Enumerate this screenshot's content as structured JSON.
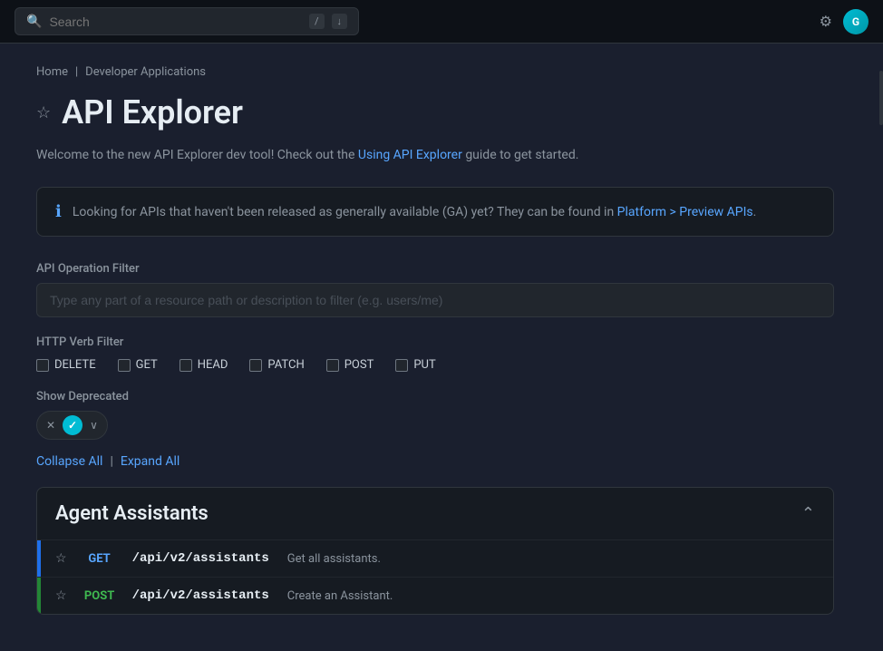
{
  "topbar": {
    "search_placeholder": "Search",
    "shortcut1": "/",
    "shortcut2": "↓",
    "settings_icon": "⚙",
    "avatar_text": "G"
  },
  "breadcrumb": {
    "home": "Home",
    "separator": "|",
    "current": "Developer Applications"
  },
  "page": {
    "star_icon": "☆",
    "title": "API Explorer",
    "subtitle_before": "Welcome to the new API Explorer dev tool! Check out the ",
    "subtitle_link_text": "Using API Explorer",
    "subtitle_after": " guide to get started."
  },
  "info_banner": {
    "icon": "ℹ",
    "text_before": "Looking for APIs that haven't been released as generally available (GA) yet? They can be found in ",
    "link_text": "Platform > Preview APIs",
    "text_after": "."
  },
  "filter": {
    "operation_label": "API Operation Filter",
    "operation_placeholder": "Type any part of a resource path or description to filter (e.g. users/me)",
    "verb_label": "HTTP Verb Filter",
    "verbs": [
      {
        "label": "DELETE",
        "checked": false
      },
      {
        "label": "GET",
        "checked": false
      },
      {
        "label": "HEAD",
        "checked": false
      },
      {
        "label": "PATCH",
        "checked": false
      },
      {
        "label": "POST",
        "checked": false
      },
      {
        "label": "PUT",
        "checked": false
      }
    ],
    "show_deprecated_label": "Show Deprecated",
    "toggle_x": "✕",
    "toggle_check": "✓",
    "toggle_chevron": "∨"
  },
  "controls": {
    "collapse_all": "Collapse All",
    "separator": "|",
    "expand_all": "Expand All"
  },
  "sections": [
    {
      "title": "Agent Assistants",
      "collapsed": false,
      "endpoints": [
        {
          "verb": "GET",
          "path": "/api/v2/assistants",
          "description": "Get all assistants.",
          "border_color": "blue"
        },
        {
          "verb": "POST",
          "path": "/api/v2/assistants",
          "description": "Create an Assistant.",
          "border_color": "green"
        }
      ]
    }
  ]
}
